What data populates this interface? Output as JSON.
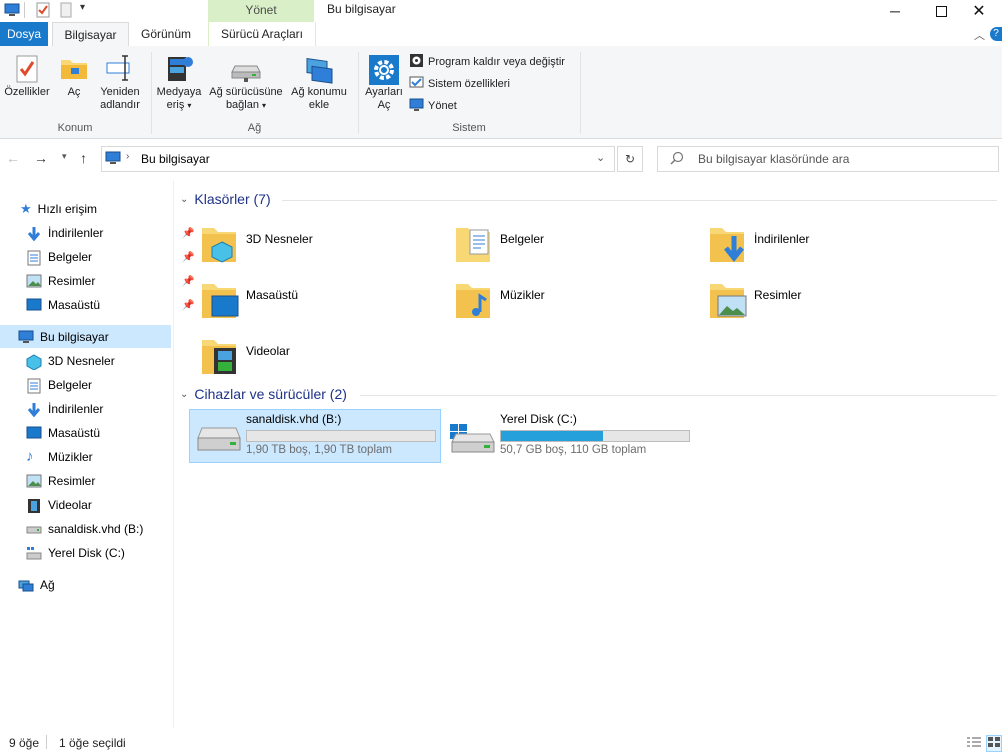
{
  "window": {
    "title": "Bu bilgisayar",
    "context_tab_header": "Yönet"
  },
  "tabs": {
    "dosya": "Dosya",
    "bilgisayar": "Bilgisayar",
    "gorunum": "Görünüm",
    "surucu_araclari": "Sürücü Araçları"
  },
  "ribbon": {
    "konum": {
      "label": "Konum",
      "ozellikler": "Özellikler",
      "ac": "Aç",
      "yeniden_line1": "Yeniden",
      "yeniden_line2": "adlandır"
    },
    "ag": {
      "label": "Ağ",
      "medyaya_line1": "Medyaya",
      "medyaya_line2": "eriş",
      "surucu_line1": "Ağ sürücüsüne",
      "surucu_line2": "bağlan",
      "konum_line1": "Ağ konumu",
      "konum_line2": "ekle"
    },
    "sistem": {
      "label": "Sistem",
      "ayarlar_line1": "Ayarları",
      "ayarlar_line2": "Aç",
      "program": "Program kaldır veya değiştir",
      "sistem_ozellikleri": "Sistem özellikleri",
      "yonet": "Yönet"
    }
  },
  "address": {
    "path": "Bu bilgisayar",
    "search_placeholder": "Bu bilgisayar klasöründe ara"
  },
  "nav": {
    "quick_access": "Hızlı erişim",
    "quick_items": [
      "İndirilenler",
      "Belgeler",
      "Resimler",
      "Masaüstü"
    ],
    "this_pc": "Bu bilgisayar",
    "pc_items": [
      "3D Nesneler",
      "Belgeler",
      "İndirilenler",
      "Masaüstü",
      "Müzikler",
      "Resimler",
      "Videolar",
      "sanaldisk.vhd (B:)",
      "Yerel Disk (C:)"
    ],
    "network": "Ağ"
  },
  "main": {
    "folders_title": "Klasörler (7)",
    "folders": [
      "3D Nesneler",
      "Belgeler",
      "İndirilenler",
      "Masaüstü",
      "Müzikler",
      "Resimler",
      "Videolar"
    ],
    "devices_title": "Cihazlar ve sürücüler (2)",
    "drives": [
      {
        "name": "sanaldisk.vhd (B:)",
        "info": "1,90 TB boş, 1,90 TB toplam",
        "used_fraction": 0.0
      },
      {
        "name": "Yerel Disk (C:)",
        "info": "50,7 GB boş, 110 GB toplam",
        "used_fraction": 0.54
      }
    ]
  },
  "status": {
    "count": "9 öğe",
    "selected": "1 öğe seçildi"
  },
  "colors": {
    "accent": "#1979ca",
    "selection": "#cce8ff",
    "bar_fill": "#26a0da",
    "context_tab": "#d8efc8"
  }
}
